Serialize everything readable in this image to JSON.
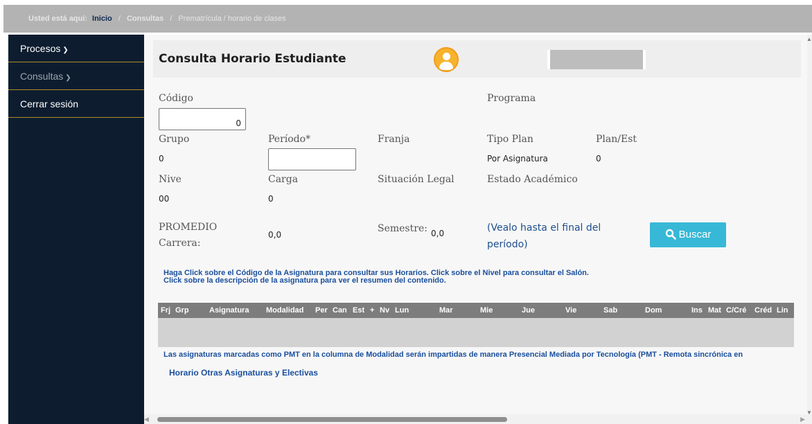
{
  "breadcrumb": {
    "prefix": "Usted está aquí:",
    "items": [
      "Inicio",
      "Consultas",
      "Prematrícula / horario de clases"
    ]
  },
  "sidebar": {
    "items": [
      {
        "label": "Procesos",
        "chevron": "chevron-down-icon"
      },
      {
        "label": "Consultas",
        "chevron": "chevron-down-icon"
      },
      {
        "label": "Cerrar sesión"
      }
    ]
  },
  "header": {
    "title": "Consulta Horario Estudiante",
    "avatar_icon": "user-avatar-icon",
    "avatar_color": "#f6b32b"
  },
  "form": {
    "codigo_label": "Código",
    "codigo_value": "0",
    "programa_label": "Programa",
    "grupo_label": "Grupo",
    "grupo_value": "0",
    "periodo_label": "Período*",
    "periodo_value": "",
    "franja_label": "Franja",
    "tipo_plan_label": "Tipo Plan",
    "tipo_plan_value": "Por Asignatura",
    "plan_est_label": "Plan/Est",
    "plan_est_value": "0",
    "nivel_label": "Nive",
    "nivel_value": "00",
    "carga_label": "Carga",
    "carga_value": "0",
    "situacion_label": "Situación Legal",
    "estado_label": "Estado Académico",
    "promedio_label_1": "PROMEDIO",
    "promedio_label_2": "Carrera:",
    "promedio_value": "0,0",
    "semestre_label": "Semestre:",
    "semestre_value": "0,0",
    "vealo_line_1": "(Vealo hasta el final del",
    "vealo_line_2": "período)",
    "buscar_label": "Buscar",
    "buscar_icon": "search-icon",
    "buscar_color": "#37b8d6"
  },
  "notice": {
    "line_1": "Haga Click sobre el Código de la Asignatura para consultar sus Horarios. Click sobre el Nivel para consultar el Salón.",
    "line_2": "Click sobre la descripción de la asignatura para ver el resumen del contenido."
  },
  "table": {
    "headers": [
      "Frj",
      "Grp",
      "Asignatura",
      "Modalidad",
      "Per",
      "Can",
      "Est",
      "+",
      "Nv",
      "Lun",
      "Mar",
      "Mie",
      "Jue",
      "Vie",
      "Sab",
      "Dom",
      "Ins",
      "Mat",
      "C/Cré",
      "Créd",
      "Lin"
    ]
  },
  "footer": {
    "pmt_note": "Las asignaturas marcadas como PMT en la columna de Modalidad serán impartidas de manera Presencial Mediada por Tecnología (PMT - Remota sincrónica en",
    "other_link": "Horario Otras Asignaturas y Electivas"
  }
}
